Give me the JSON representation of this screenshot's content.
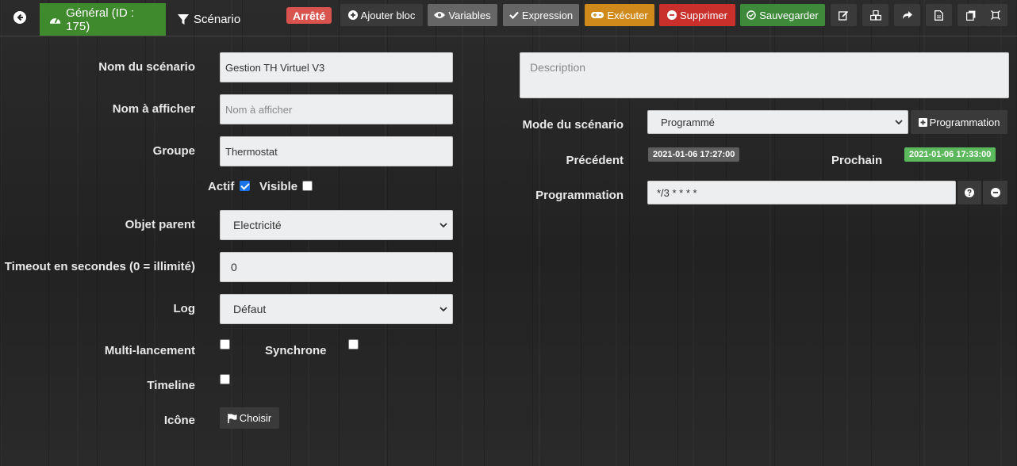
{
  "header": {
    "tabs": [
      {
        "label": "Général (ID : 175)",
        "icon": "dashboard-icon"
      },
      {
        "label": "Scénario",
        "icon": "filter-icon"
      }
    ],
    "status": "Arrêté",
    "status_color": "#d9534f",
    "buttons": {
      "add_block": "Ajouter bloc",
      "variables": "Variables",
      "expression": "Expression",
      "execute": "Exécuter",
      "delete": "Supprimer",
      "save": "Sauvegarder"
    }
  },
  "form": {
    "name_label": "Nom du scénario",
    "name_value": "Gestion TH Virtuel V3",
    "display_name_label": "Nom à afficher",
    "display_name_placeholder": "Nom à afficher",
    "group_label": "Groupe",
    "group_value": "Thermostat",
    "active_label": "Actif",
    "active_checked": true,
    "visible_label": "Visible",
    "visible_checked": false,
    "parent_label": "Objet parent",
    "parent_value": "Electricité",
    "timeout_label": "Timeout en secondes (0 = illimité)",
    "timeout_value": "0",
    "log_label": "Log",
    "log_value": "Défaut",
    "multi_label": "Multi-lancement",
    "multi_checked": false,
    "sync_label": "Synchrone",
    "sync_checked": false,
    "timeline_label": "Timeline",
    "timeline_checked": false,
    "icon_label": "Icône",
    "icon_button": "Choisir"
  },
  "right": {
    "description_placeholder": "Description",
    "mode_label": "Mode du scénario",
    "mode_value": "Programmé",
    "programmation_button": "Programmation",
    "previous_label": "Précédent",
    "previous_value": "2021-01-06 17:27:00",
    "next_label": "Prochain",
    "next_value": "2021-01-06 17:33:00",
    "schedule_label": "Programmation",
    "schedule_value": "*/3 * * * *"
  }
}
